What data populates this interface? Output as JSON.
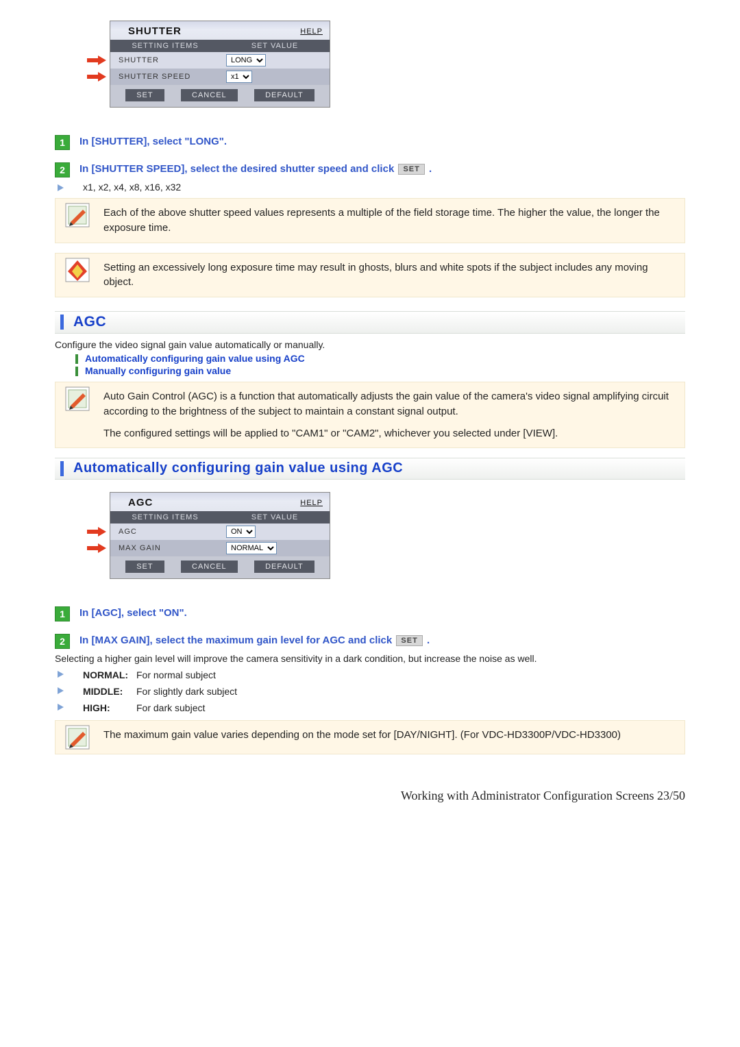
{
  "shutter_panel": {
    "title": "SHUTTER",
    "help": "HELP",
    "head_items": "SETTING ITEMS",
    "head_value": "SET VALUE",
    "rows": [
      {
        "label": "SHUTTER",
        "value": "LONG"
      },
      {
        "label": "SHUTTER SPEED",
        "value": "x1"
      }
    ],
    "buttons": {
      "set": "SET",
      "cancel": "CANCEL",
      "default": "DEFAULT"
    }
  },
  "shutter_steps": {
    "s1": "In [SHUTTER], select \"LONG\".",
    "s2a": "In [SHUTTER SPEED], select the desired shutter speed and click ",
    "s2_set": "SET",
    "s2b": " .",
    "speeds": "x1, x2, x4, x8, x16, x32"
  },
  "notes": {
    "n1": "Each of the above shutter speed values represents a multiple of the field storage time. The higher the value, the longer the exposure time.",
    "n2": "Setting an excessively long exposure time may result in ghosts, blurs and white spots if the subject includes any moving object."
  },
  "agc": {
    "title": "AGC",
    "intro": "Configure the video signal gain value automatically or manually.",
    "link1": "Automatically configuring gain value using AGC",
    "link2": "Manually configuring gain value",
    "note_p1": "Auto Gain Control (AGC) is a function that automatically adjusts the gain value of the camera's video signal amplifying circuit according to the brightness of the subject to maintain a constant signal output.",
    "note_p2": "The configured settings will be applied to \"CAM1\" or \"CAM2\", whichever you selected under [VIEW]."
  },
  "agc_auto_heading": "Automatically configuring gain value using AGC",
  "agc_panel": {
    "title": "AGC",
    "help": "HELP",
    "head_items": "SETTING ITEMS",
    "head_value": "SET VALUE",
    "rows": [
      {
        "label": "AGC",
        "value": "ON"
      },
      {
        "label": "MAX GAIN",
        "value": "NORMAL"
      }
    ],
    "buttons": {
      "set": "SET",
      "cancel": "CANCEL",
      "default": "DEFAULT"
    }
  },
  "agc_steps": {
    "s1": "In [AGC], select \"ON\".",
    "s2a": "In [MAX GAIN], select the maximum gain level for AGC and click ",
    "s2_set": "SET",
    "s2b": " .",
    "intro2": "Selecting a higher gain level will improve the camera sensitivity in a dark condition, but increase the noise as well.",
    "options": [
      {
        "key": "NORMAL:",
        "desc": "For normal subject"
      },
      {
        "key": "MIDDLE:",
        "desc": "For slightly dark subject"
      },
      {
        "key": "HIGH:",
        "desc": "For dark subject"
      }
    ],
    "note": "The maximum gain value varies depending on the mode set for [DAY/NIGHT]. (For VDC-HD3300P/VDC-HD3300)"
  },
  "footer": "Working with Administrator Configuration Screens 23/50"
}
